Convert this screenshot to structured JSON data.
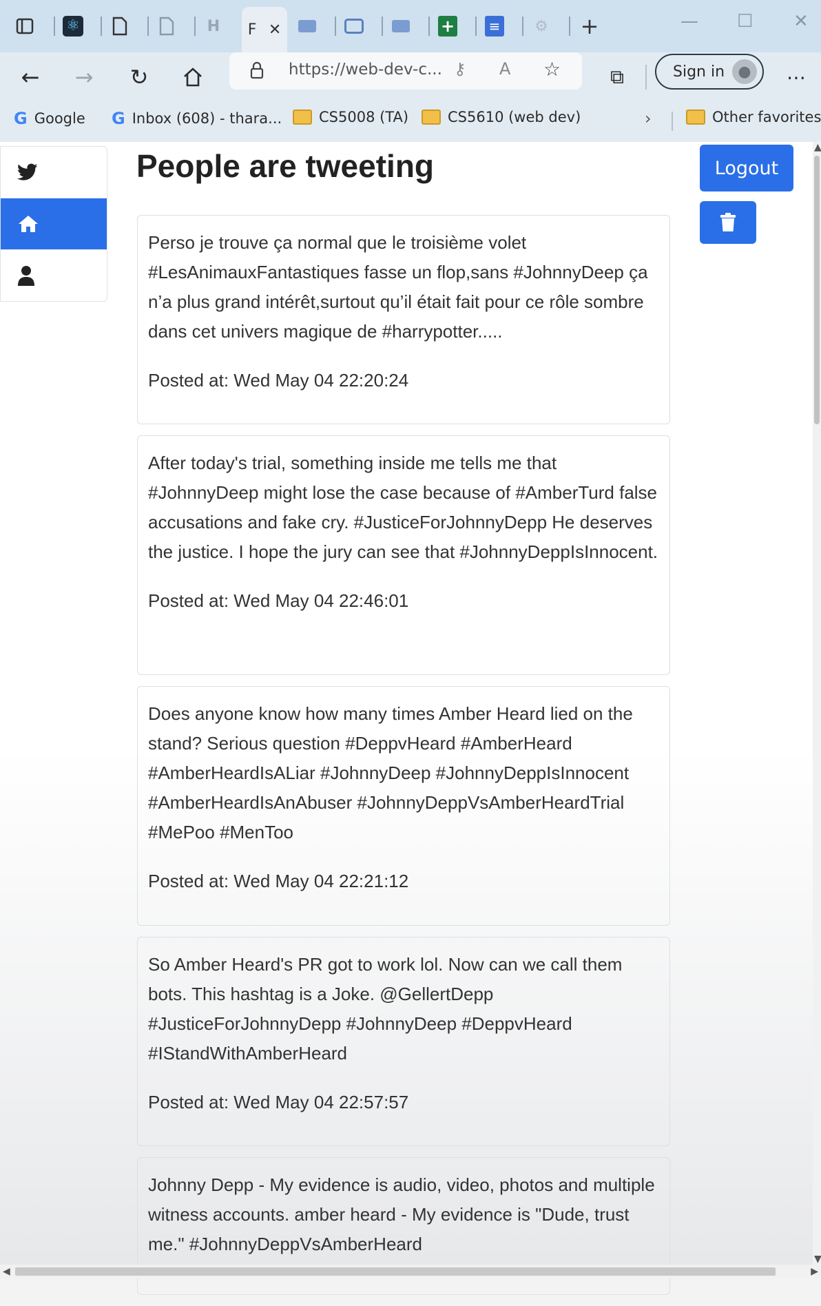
{
  "browser": {
    "tab_title": "F",
    "url": "https://web-dev-c...",
    "sign_in_label": "Sign in",
    "favorites": [
      {
        "label": "Google"
      },
      {
        "label": "Inbox (608) - thara..."
      },
      {
        "label": "CS5008 (TA)"
      },
      {
        "label": "CS5610 (web dev)"
      }
    ],
    "other_favorites": "Other favorites"
  },
  "page": {
    "title": "People are tweeting",
    "logout_label": "Logout"
  },
  "tweets": [
    {
      "text": "Perso je trouve ça normal que le troisième volet #LesAnimauxFantastiques fasse un flop,sans #JohnnyDeep ça n’a plus grand intérêt,surtout qu’il était fait pour ce rôle sombre dans cet univers magique de #harrypotter.....",
      "posted": "Posted at: Wed May 04 22:20:24"
    },
    {
      "text": "After today's trial, something inside me tells me that #JohnnyDeep might lose the case because of #AmberTurd false accusations and fake cry. #JusticeForJohnnyDepp He deserves the justice. I hope the jury can see that #JohnnyDeppIsInnocent.",
      "posted": "Posted at: Wed May 04 22:46:01"
    },
    {
      "text": "Does anyone know how many times Amber Heard lied on the stand? Serious question #DeppvHeard #AmberHeard #AmberHeardIsALiar #JohnnyDeep #JohnnyDeppIsInnocent #AmberHeardIsAnAbuser #JohnnyDeppVsAmberHeardTrial #MePoo #MenToo",
      "posted": "Posted at: Wed May 04 22:21:12"
    },
    {
      "text": "So Amber Heard's PR got to work lol. Now can we call them bots. This hashtag is a Joke. @GellertDepp #JusticeForJohnnyDepp #JohnnyDeep #DeppvHeard #IStandWithAmberHeard",
      "posted": "Posted at: Wed May 04 22:57:57"
    },
    {
      "text": "Johnny Depp - My evidence is audio, video, photos and multiple witness accounts. amber heard - My evidence is \"Dude, trust me.\" #JohnnyDeppVsAmberHeard",
      "posted": ""
    }
  ],
  "colors": {
    "primary": "#2a6fe7",
    "chrome_tabbar": "#cfe0ef",
    "chrome_toolbar": "#e3ebf2"
  }
}
